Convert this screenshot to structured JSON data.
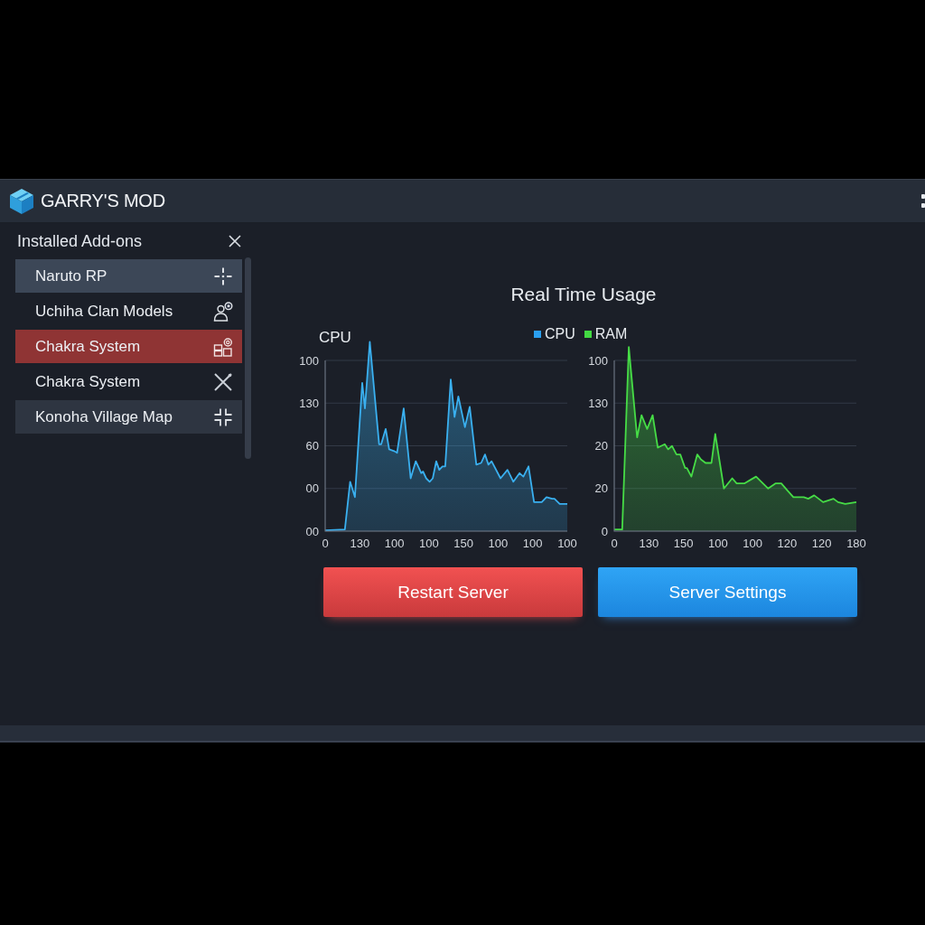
{
  "window": {
    "title": "GARRY'S MOD"
  },
  "sidebar": {
    "title": "Installed Add-ons",
    "items": [
      {
        "label": "Naruto RP",
        "selected": false,
        "hovered": true,
        "shaded": false
      },
      {
        "label": "Uchiha Clan Models",
        "selected": false,
        "hovered": false,
        "shaded": false
      },
      {
        "label": "Chakra System",
        "selected": true,
        "hovered": false,
        "shaded": false
      },
      {
        "label": "Chakra System",
        "selected": false,
        "hovered": false,
        "shaded": false
      },
      {
        "label": "Konoha Village Map",
        "selected": false,
        "hovered": false,
        "shaded": true
      }
    ]
  },
  "usage": {
    "title": "Real Time Usage",
    "legend": [
      {
        "label": "CPU",
        "color": "#2a9ff0"
      },
      {
        "label": "RAM",
        "color": "#42d942"
      }
    ],
    "charts": [
      {
        "title": "CPU",
        "color": "#3ab0f0",
        "y_ticks": [
          "100",
          "130",
          "60",
          "00",
          "00"
        ],
        "x_ticks": [
          "0",
          "130",
          "100",
          "100",
          "150",
          "100",
          "100",
          "100"
        ]
      },
      {
        "color": "#46dc46",
        "y_ticks": [
          "100",
          "130",
          "20",
          "20",
          "0"
        ],
        "x_ticks": [
          "0",
          "130",
          "150",
          "100",
          "100",
          "120",
          "120",
          "180"
        ]
      }
    ]
  },
  "buttons": [
    {
      "label": "Restart Server",
      "kind": "danger"
    },
    {
      "label": "Server Settings",
      "kind": "primary"
    }
  ]
}
